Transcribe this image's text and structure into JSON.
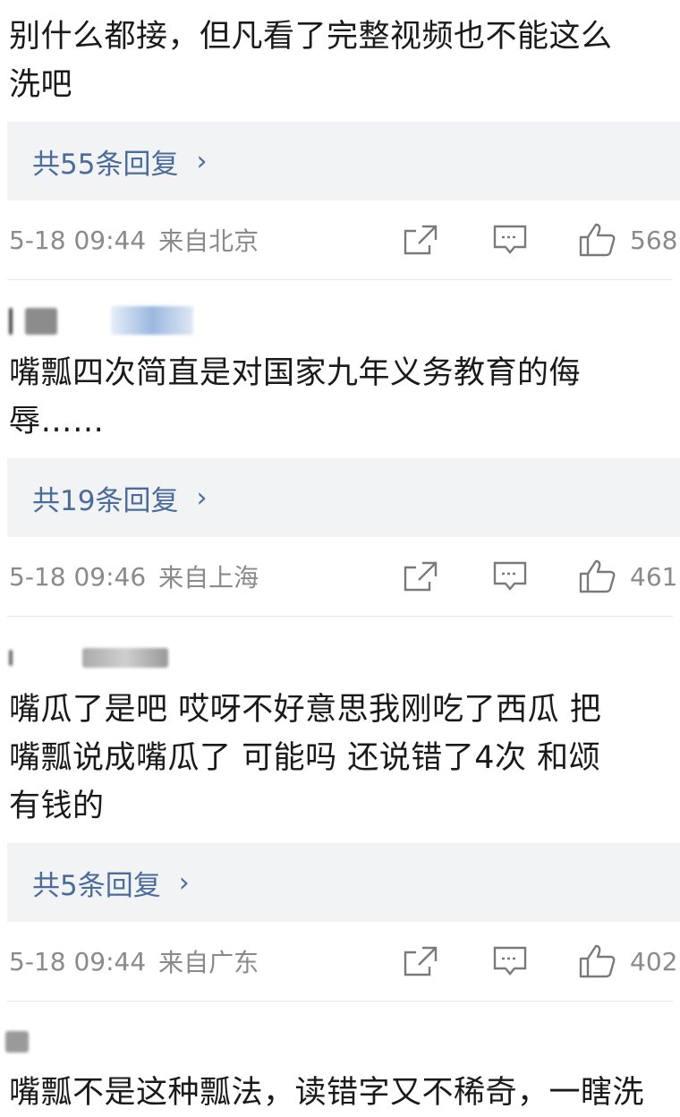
{
  "comments": [
    {
      "text_lines": [
        "别什么都接，但凡看了完整视频也不能这么",
        "洗吧"
      ],
      "reply_label": "共55条回复",
      "time": "5-18 09:44",
      "location": "来自北京",
      "likes": "568"
    },
    {
      "text_lines": [
        "嘴瓢四次简直是对国家九年义务教育的侮",
        "辱……"
      ],
      "reply_label": "共19条回复",
      "time": "5-18 09:46",
      "location": "来自上海",
      "likes": "461"
    },
    {
      "text_lines": [
        "嘴瓜了是吧 哎呀不好意思我刚吃了西瓜 把",
        "嘴瓢说成嘴瓜了 可能吗 还说错了4次 和颂",
        "有钱的"
      ],
      "reply_label": "共5条回复",
      "time": "5-18 09:44",
      "location": "来自广东",
      "likes": "402"
    },
    {
      "text_lines": [
        "嘴瓢不是这种瓢法，读错字又不稀奇，一瞎洗"
      ]
    }
  ],
  "icons": {
    "share": "share-icon",
    "reply": "comment-icon",
    "like": "thumbs-up-icon",
    "chevron": "chevron-right-icon"
  },
  "colors": {
    "link": "#4b6c9b",
    "meta": "#8a8a8a",
    "reply_bg": "#f2f3f5"
  }
}
